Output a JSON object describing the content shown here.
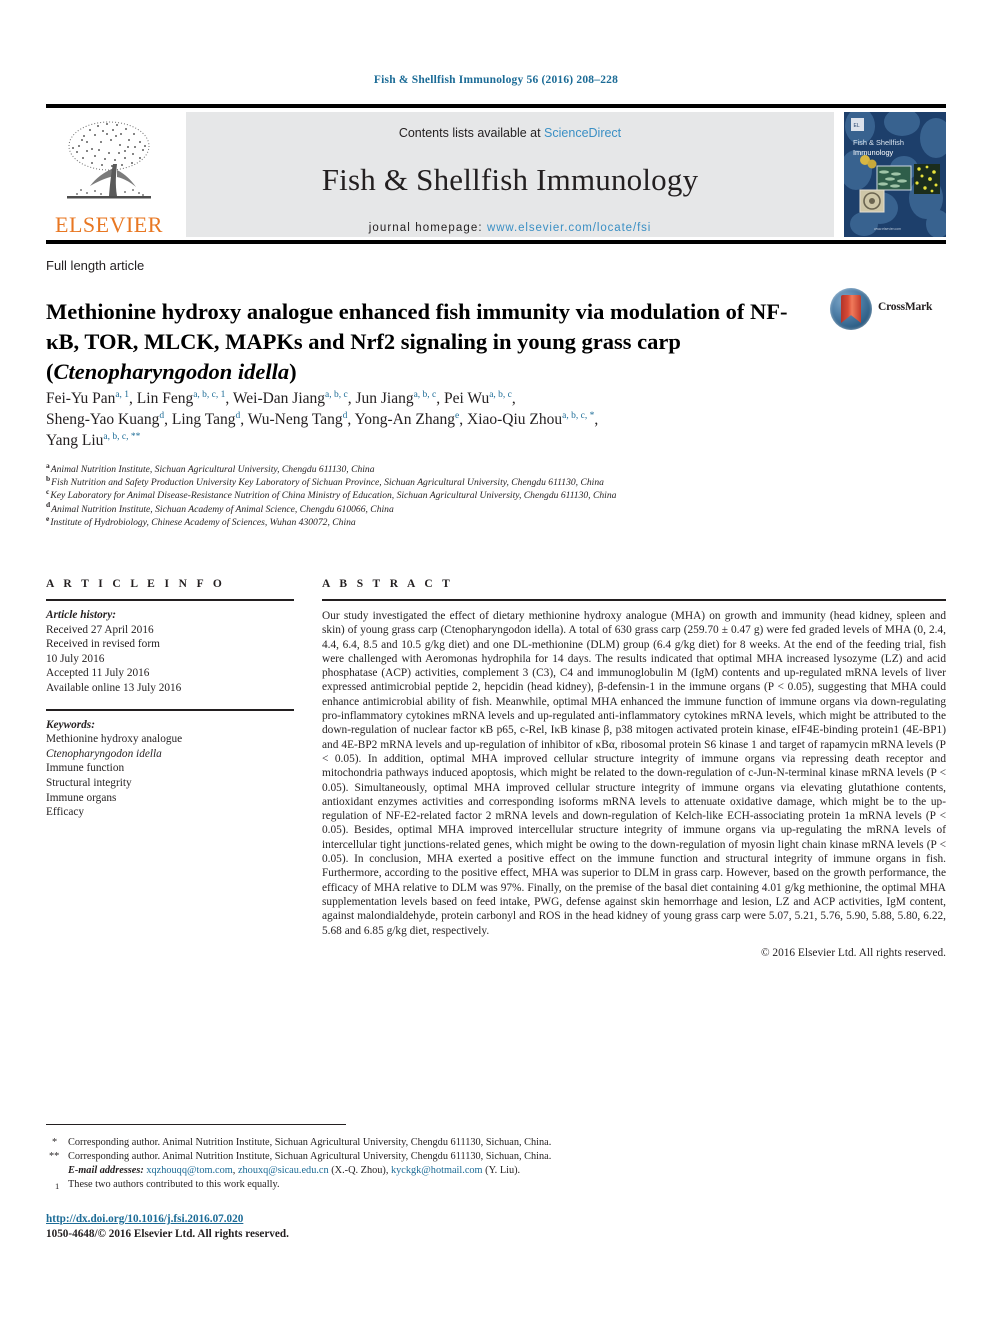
{
  "running_head": "Fish & Shellfish Immunology 56 (2016) 208–228",
  "masthead": {
    "publisher": "ELSEVIER",
    "contents_prefix": "Contents lists available at ",
    "contents_link": "ScienceDirect",
    "journal_title": "Fish & Shellfish Immunology",
    "homepage_label": "journal homepage: ",
    "homepage_url": "www.elsevier.com/locate/fsi",
    "cover_title_line1": "Fish & Shellfish",
    "cover_title_line2": "Immunology",
    "cover_footer": "www.elsevier.com"
  },
  "article": {
    "type": "Full length article",
    "title_part1": "Methionine hydroxy analogue enhanced fish immunity via modulation of NF-κB, TOR, MLCK, MAPKs and Nrf2 signaling in young grass carp (",
    "title_species": "Ctenopharyngodon idella",
    "title_part2": ")",
    "crossmark_label": "CrossMark"
  },
  "authors": [
    {
      "name": "Fei-Yu Pan",
      "sup": "a, 1"
    },
    {
      "name": "Lin Feng",
      "sup": "a, b, c, 1"
    },
    {
      "name": "Wei-Dan Jiang",
      "sup": "a, b, c"
    },
    {
      "name": "Jun Jiang",
      "sup": "a, b, c"
    },
    {
      "name": "Pei Wu",
      "sup": "a, b, c"
    },
    {
      "name": "Sheng-Yao Kuang",
      "sup": "d"
    },
    {
      "name": "Ling Tang",
      "sup": "d"
    },
    {
      "name": "Wu-Neng Tang",
      "sup": "d"
    },
    {
      "name": "Yong-An Zhang",
      "sup": "e"
    },
    {
      "name": "Xiao-Qiu Zhou",
      "sup": "a, b, c, *"
    },
    {
      "name": "Yang Liu",
      "sup": "a, b, c, **"
    }
  ],
  "affiliations": [
    {
      "mark": "a",
      "text": "Animal Nutrition Institute, Sichuan Agricultural University, Chengdu 611130, China"
    },
    {
      "mark": "b",
      "text": "Fish Nutrition and Safety Production University Key Laboratory of Sichuan Province, Sichuan Agricultural University, Chengdu 611130, China"
    },
    {
      "mark": "c",
      "text": "Key Laboratory for Animal Disease-Resistance Nutrition of China Ministry of Education, Sichuan Agricultural University, Chengdu 611130, China"
    },
    {
      "mark": "d",
      "text": "Animal Nutrition Institute, Sichuan Academy of Animal Science, Chengdu 610066, China"
    },
    {
      "mark": "e",
      "text": "Institute of Hydrobiology, Chinese Academy of Sciences, Wuhan 430072, China"
    }
  ],
  "article_info": {
    "heading": "A R T I C L E   I N F O",
    "history_label": "Article history:",
    "history": [
      "Received 27 April 2016",
      "Received in revised form",
      "10 July 2016",
      "Accepted 11 July 2016",
      "Available online 13 July 2016"
    ],
    "keywords_label": "Keywords:",
    "keywords": [
      "Methionine hydroxy analogue",
      "Ctenopharyngodon idella",
      "Immune function",
      "Structural integrity",
      "Immune organs",
      "Efficacy"
    ],
    "keyword_italic_index": 1
  },
  "abstract": {
    "heading": "A B S T R A C T",
    "body": "Our study investigated the effect of dietary methionine hydroxy analogue (MHA) on growth and immunity (head kidney, spleen and skin) of young grass carp (Ctenopharyngodon idella). A total of 630 grass carp (259.70 ± 0.47 g) were fed graded levels of MHA (0, 2.4, 4.4, 6.4, 8.5 and 10.5 g/kg diet) and one DL-methionine (DLM) group (6.4 g/kg diet) for 8 weeks. At the end of the feeding trial, fish were challenged with Aeromonas hydrophila for 14 days. The results indicated that optimal MHA increased lysozyme (LZ) and acid phosphatase (ACP) activities, complement 3 (C3), C4 and immunoglobulin M (IgM) contents and up-regulated mRNA levels of liver expressed antimicrobial peptide 2, hepcidin (head kidney), β-defensin-1 in the immune organs (P < 0.05), suggesting that MHA could enhance antimicrobial ability of fish. Meanwhile, optimal MHA enhanced the immune function of immune organs via down-regulating pro-inflammatory cytokines mRNA levels and up-regulated anti-inflammatory cytokines mRNA levels, which might be attributed to the down-regulation of nuclear factor κB p65, c-Rel, IκB kinase β, p38 mitogen activated protein kinase, eIF4E-binding protein1 (4E-BP1) and 4E-BP2 mRNA levels and up-regulation of inhibitor of κBα, ribosomal protein S6 kinase 1 and target of rapamycin mRNA levels (P < 0.05). In addition, optimal MHA improved cellular structure integrity of immune organs via repressing death receptor and mitochondria pathways induced apoptosis, which might be related to the down-regulation of c-Jun-N-terminal kinase mRNA levels (P < 0.05). Simultaneously, optimal MHA improved cellular structure integrity of immune organs via elevating glutathione contents, antioxidant enzymes activities and corresponding isoforms mRNA levels to attenuate oxidative damage, which might be to the up-regulation of NF-E2-related factor 2 mRNA levels and down-regulation of Kelch-like ECH-associating protein 1a mRNA levels (P < 0.05). Besides, optimal MHA improved intercellular structure integrity of immune organs via up-regulating the mRNA levels of intercellular tight junctions-related genes, which might be owing to the down-regulation of myosin light chain kinase mRNA levels (P < 0.05). In conclusion, MHA exerted a positive effect on the immune function and structural integrity of immune organs in fish. Furthermore, according to the positive effect, MHA was superior to DLM in grass carp. However, based on the growth performance, the efficacy of MHA relative to DLM was 97%. Finally, on the premise of the basal diet containing 4.01 g/kg methionine, the optimal MHA supplementation levels based on feed intake, PWG, defense against skin hemorrhage and lesion, LZ and ACP activities, IgM content, against malondialdehyde, protein carbonyl and ROS in the head kidney of young grass carp were 5.07, 5.21, 5.76, 5.90, 5.88, 5.80, 6.22, 5.68 and 6.85 g/kg diet, respectively.",
    "copyright": "© 2016 Elsevier Ltd. All rights reserved."
  },
  "footnotes": {
    "corresponding_1": "Corresponding author. Animal Nutrition Institute, Sichuan Agricultural University, Chengdu 611130, Sichuan, China.",
    "corresponding_2": "Corresponding author. Animal Nutrition Institute, Sichuan Agricultural University, Chengdu 611130, Sichuan, China.",
    "email_label": "E-mail addresses:",
    "email_1": "xqzhouqq@tom.com",
    "email_2": "zhouxq@sicau.edu.cn",
    "email_owner_1": "(X.-Q. Zhou),",
    "email_3": "kyckgk@hotmail.com",
    "email_owner_2": "(Y. Liu).",
    "equal_contribution": "These two authors contributed to this work equally."
  },
  "footer": {
    "doi": "http://dx.doi.org/10.1016/j.fsi.2016.07.020",
    "issn_line": "1050-4648/© 2016 Elsevier Ltd. All rights reserved."
  },
  "colors": {
    "link": "#1b6b96",
    "elsevier_orange": "#e87722",
    "banner_grey": "#e6e7e8",
    "sciencedirect_blue": "#3a8fc4",
    "cover_navy": "#1d3a6b"
  }
}
